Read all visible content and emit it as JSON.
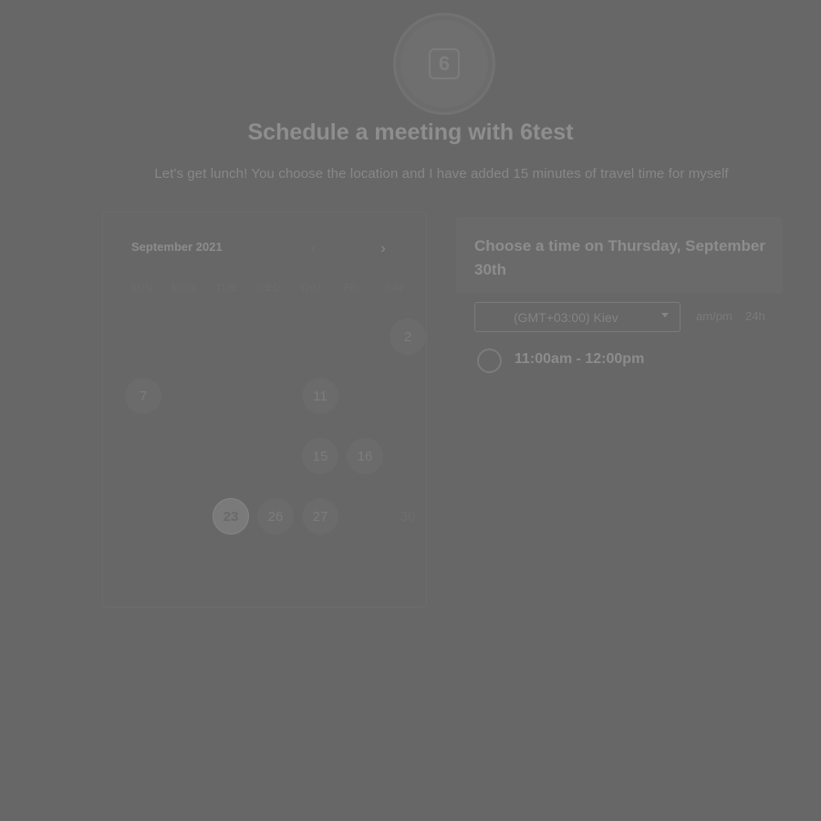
{
  "header": {
    "avatar_initial": "6",
    "title": "Schedule a meeting with 6test",
    "description": "Let's get lunch! You choose the location and I have added 15 minutes of travel time for myself"
  },
  "calendar": {
    "month_label": "September 2021",
    "prev_icon": "chevron-left-icon",
    "next_icon": "chevron-right-icon",
    "weekdays": [
      "SUN",
      "MON",
      "TUE",
      "WED",
      "THU",
      "FRI",
      "SAT"
    ],
    "days": {
      "d2": "2",
      "d7": "7",
      "d11": "11",
      "d15": "15",
      "d16": "16",
      "d23": "23",
      "d26": "26",
      "d27": "27",
      "d30": "30"
    },
    "selected_day": "30"
  },
  "time_panel": {
    "heading": "Choose a time on Thursday, September 30th",
    "timezone_value": "(GMT+03:00) Kiev",
    "format_ampm": "am/pm",
    "format_24h": "24h",
    "slots": [
      "11:00am - 12:00pm"
    ]
  },
  "colors": {
    "overlay": "#676767"
  }
}
